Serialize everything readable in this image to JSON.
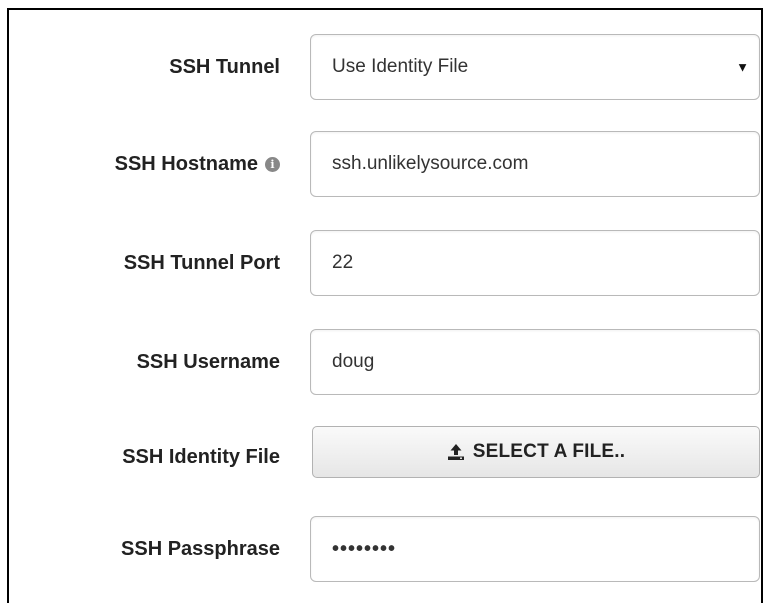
{
  "form": {
    "ssh_tunnel": {
      "label": "SSH Tunnel",
      "value": "Use Identity File"
    },
    "ssh_hostname": {
      "label": "SSH Hostname",
      "value": "ssh.unlikelysource.com"
    },
    "ssh_tunnel_port": {
      "label": "SSH Tunnel Port",
      "value": "22"
    },
    "ssh_username": {
      "label": "SSH Username",
      "value": "doug"
    },
    "ssh_identity_file": {
      "label": "SSH Identity File",
      "button_label": "SELECT A FILE.."
    },
    "ssh_passphrase": {
      "label": "SSH Passphrase",
      "value": "••••••••"
    }
  },
  "icons": {
    "info": "info-icon",
    "dropdown": "caret-down-icon",
    "upload": "upload-icon"
  }
}
